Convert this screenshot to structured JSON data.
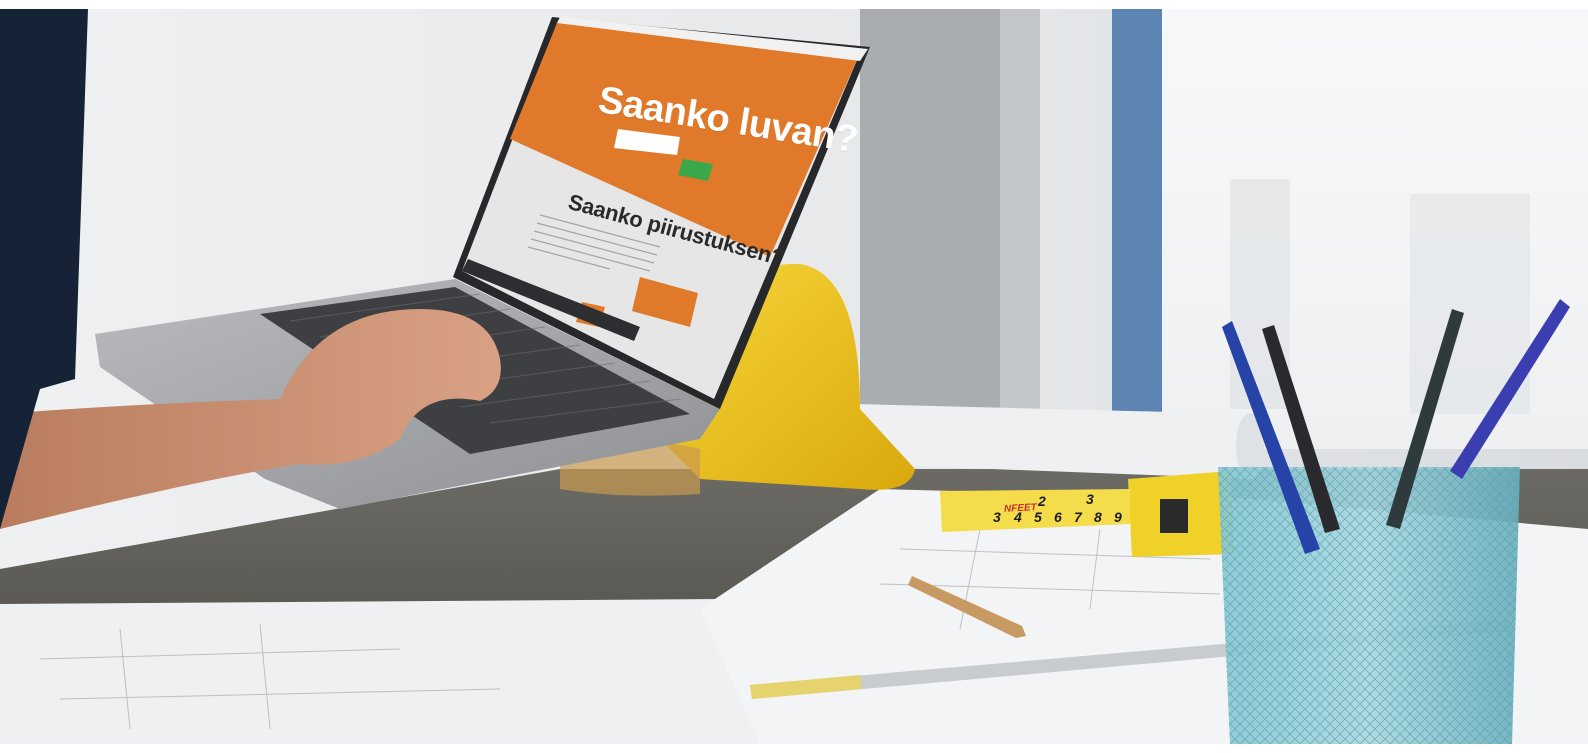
{
  "screen": {
    "headline": "Saanko luvan?",
    "subheadline": "Saanko piirustuksen?"
  },
  "colors": {
    "page_orange": "#e0792a",
    "screen_gray": "#e6e6e6",
    "green_button": "#3aa84a",
    "helmet_yellow": "#f2c41a",
    "tape_yellow": "#f0d127",
    "cup_teal": "#6fb9c6"
  },
  "tape": {
    "brand": "NFEET",
    "numbers": [
      "2",
      "3",
      "3",
      "4",
      "5",
      "6",
      "7",
      "8",
      "9"
    ]
  }
}
